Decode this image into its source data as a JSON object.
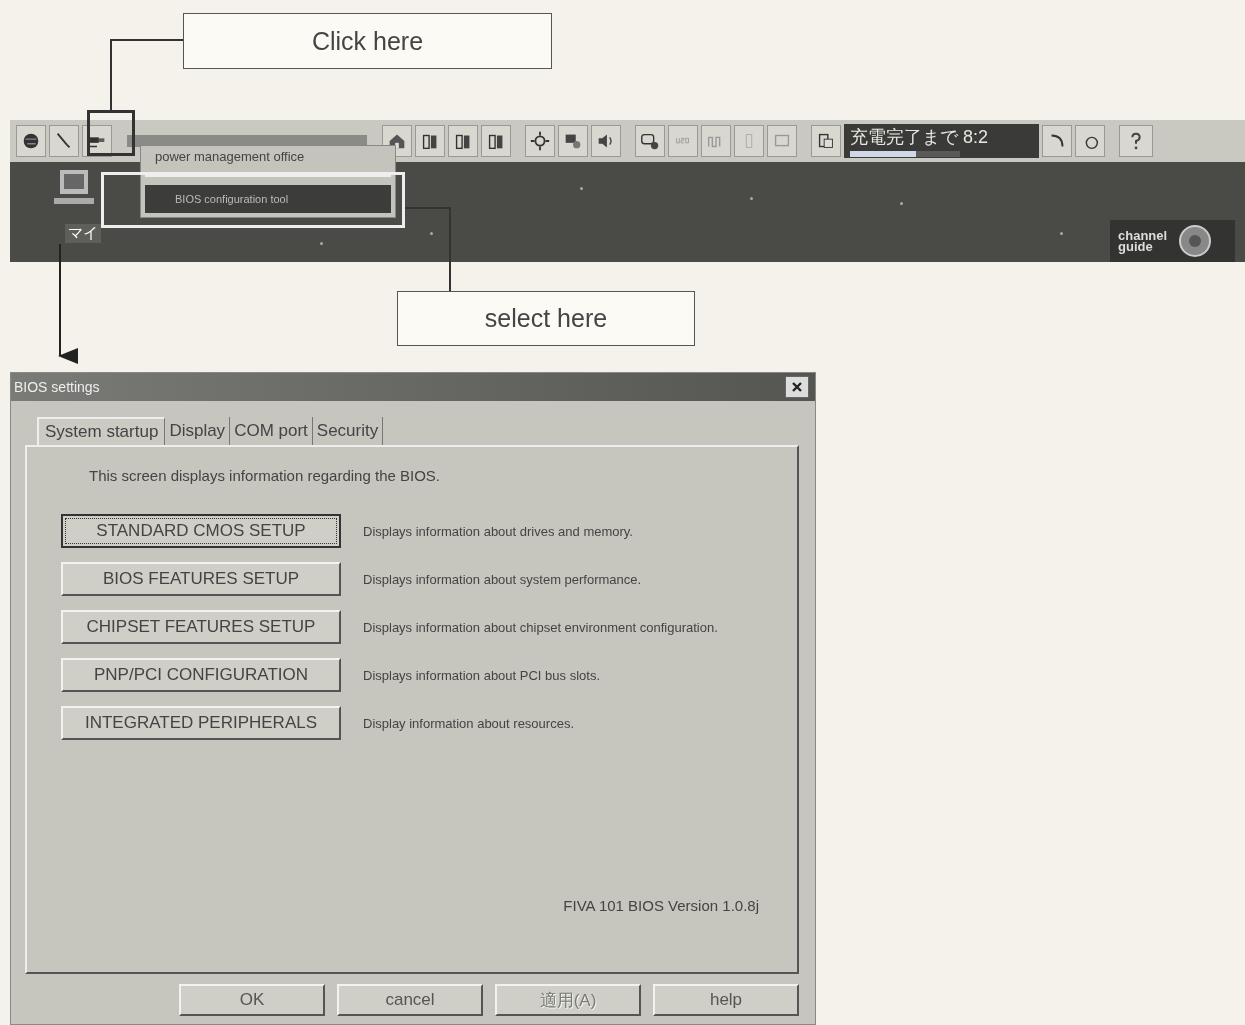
{
  "callouts": [
    {
      "label": "Click here"
    },
    {
      "label": "select here"
    }
  ],
  "taskbar": {
    "battery": {
      "text": "充電完了まで 8:2",
      "level": 0.6
    },
    "menu": [
      {
        "label": "power management office",
        "selected": false
      },
      {
        "label": "BIOS configuration tool",
        "selected": true
      }
    ]
  },
  "desktop": {
    "icon_label": "マイ",
    "badge": [
      "channel",
      "guide"
    ]
  },
  "dialog": {
    "title": "BIOS settings",
    "tabs": [
      {
        "label": "System startup",
        "selected": true
      },
      {
        "label": "Display",
        "selected": false
      },
      {
        "label": "COM port",
        "selected": false
      },
      {
        "label": "Security",
        "selected": false
      }
    ],
    "intro": "This screen displays information regarding the BIOS.",
    "options": [
      {
        "button": "STANDARD CMOS SETUP",
        "description": "Displays information about drives and memory.",
        "focused": true
      },
      {
        "button": "BIOS FEATURES SETUP",
        "description": "Displays information about system performance.",
        "focused": false
      },
      {
        "button": "CHIPSET FEATURES SETUP",
        "description": "Displays information about chipset environment configuration.",
        "focused": false
      },
      {
        "button": "PNP/PCI CONFIGURATION",
        "description": "Displays information about PCI bus slots.",
        "focused": false
      },
      {
        "button": "INTEGRATED PERIPHERALS",
        "description": "Display information about resources.",
        "focused": false
      }
    ],
    "version": "FIVA 101 BIOS Version 1.0.8j",
    "buttons": [
      {
        "label": "OK",
        "disabled": false
      },
      {
        "label": "cancel",
        "disabled": false
      },
      {
        "label": "適用(A)",
        "disabled": true
      },
      {
        "label": "help",
        "disabled": false
      }
    ]
  }
}
